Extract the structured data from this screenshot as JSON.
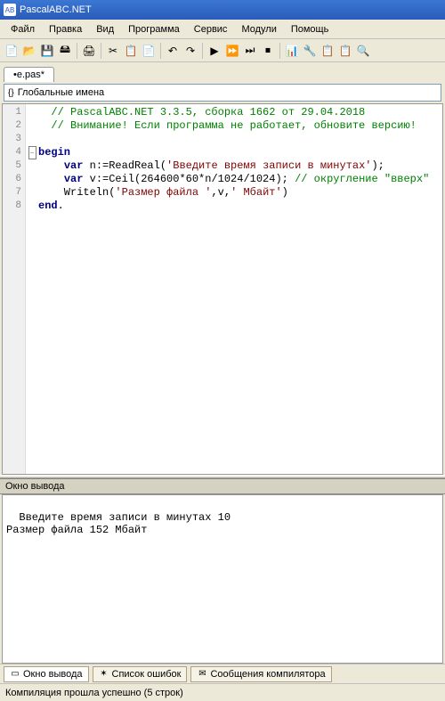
{
  "window": {
    "title": "PascalABC.NET"
  },
  "menu": {
    "items": [
      "Файл",
      "Правка",
      "Вид",
      "Программа",
      "Сервис",
      "Модули",
      "Помощь"
    ]
  },
  "tab": {
    "filename": "•e.pas*"
  },
  "names_dropdown": {
    "label": "Глобальные имена"
  },
  "code": {
    "lines": [
      {
        "n": 1,
        "type": "comment",
        "text": "  // PascalABC.NET 3.3.5, сборка 1662 от 29.04.2018"
      },
      {
        "n": 2,
        "type": "comment",
        "text": "  // Внимание! Если программа не работает, обновите версию!"
      },
      {
        "n": 3,
        "type": "blank",
        "text": ""
      },
      {
        "n": 4,
        "type": "begin",
        "kw": "begin"
      },
      {
        "n": 5,
        "type": "var",
        "pre": "    ",
        "kw": "var",
        "middle": " n:=ReadReal(",
        "str": "'Введите время записи в минутах'",
        "post": ");"
      },
      {
        "n": 6,
        "type": "var",
        "pre": "    ",
        "kw": "var",
        "middle": " v:=Ceil(264600*60*n/1024/1024); ",
        "comment": "// округление \"вверх\""
      },
      {
        "n": 7,
        "type": "writeln",
        "pre": "    Writeln(",
        "str1": "'Размер файла '",
        "mid": ",v,",
        "str2": "' Мбайт'",
        "post": ")"
      },
      {
        "n": 8,
        "type": "end",
        "kw": "end",
        "post": "."
      }
    ]
  },
  "output": {
    "header": "Окно вывода",
    "text": "Введите время записи в минутах 10\nРазмер файла 152 Мбайт"
  },
  "bottom_tabs": {
    "items": [
      {
        "label": "Окно вывода",
        "icon": "▭",
        "active": true
      },
      {
        "label": "Список ошибок",
        "icon": "✶",
        "active": false
      },
      {
        "label": "Сообщения компилятора",
        "icon": "✉",
        "active": false
      }
    ]
  },
  "status": {
    "text": "Компиляция прошла успешно (5 строк)"
  },
  "toolbar_icons": [
    "📄",
    "📂",
    "💾",
    "🖴",
    "|",
    "🖨",
    "|",
    "✂",
    "📋",
    "📄",
    "|",
    "↶",
    "↷",
    "|",
    "▶",
    "⏩",
    "⏭",
    "⏹",
    "|",
    "📊",
    "🔧",
    "📋",
    "📋",
    "🔍"
  ]
}
